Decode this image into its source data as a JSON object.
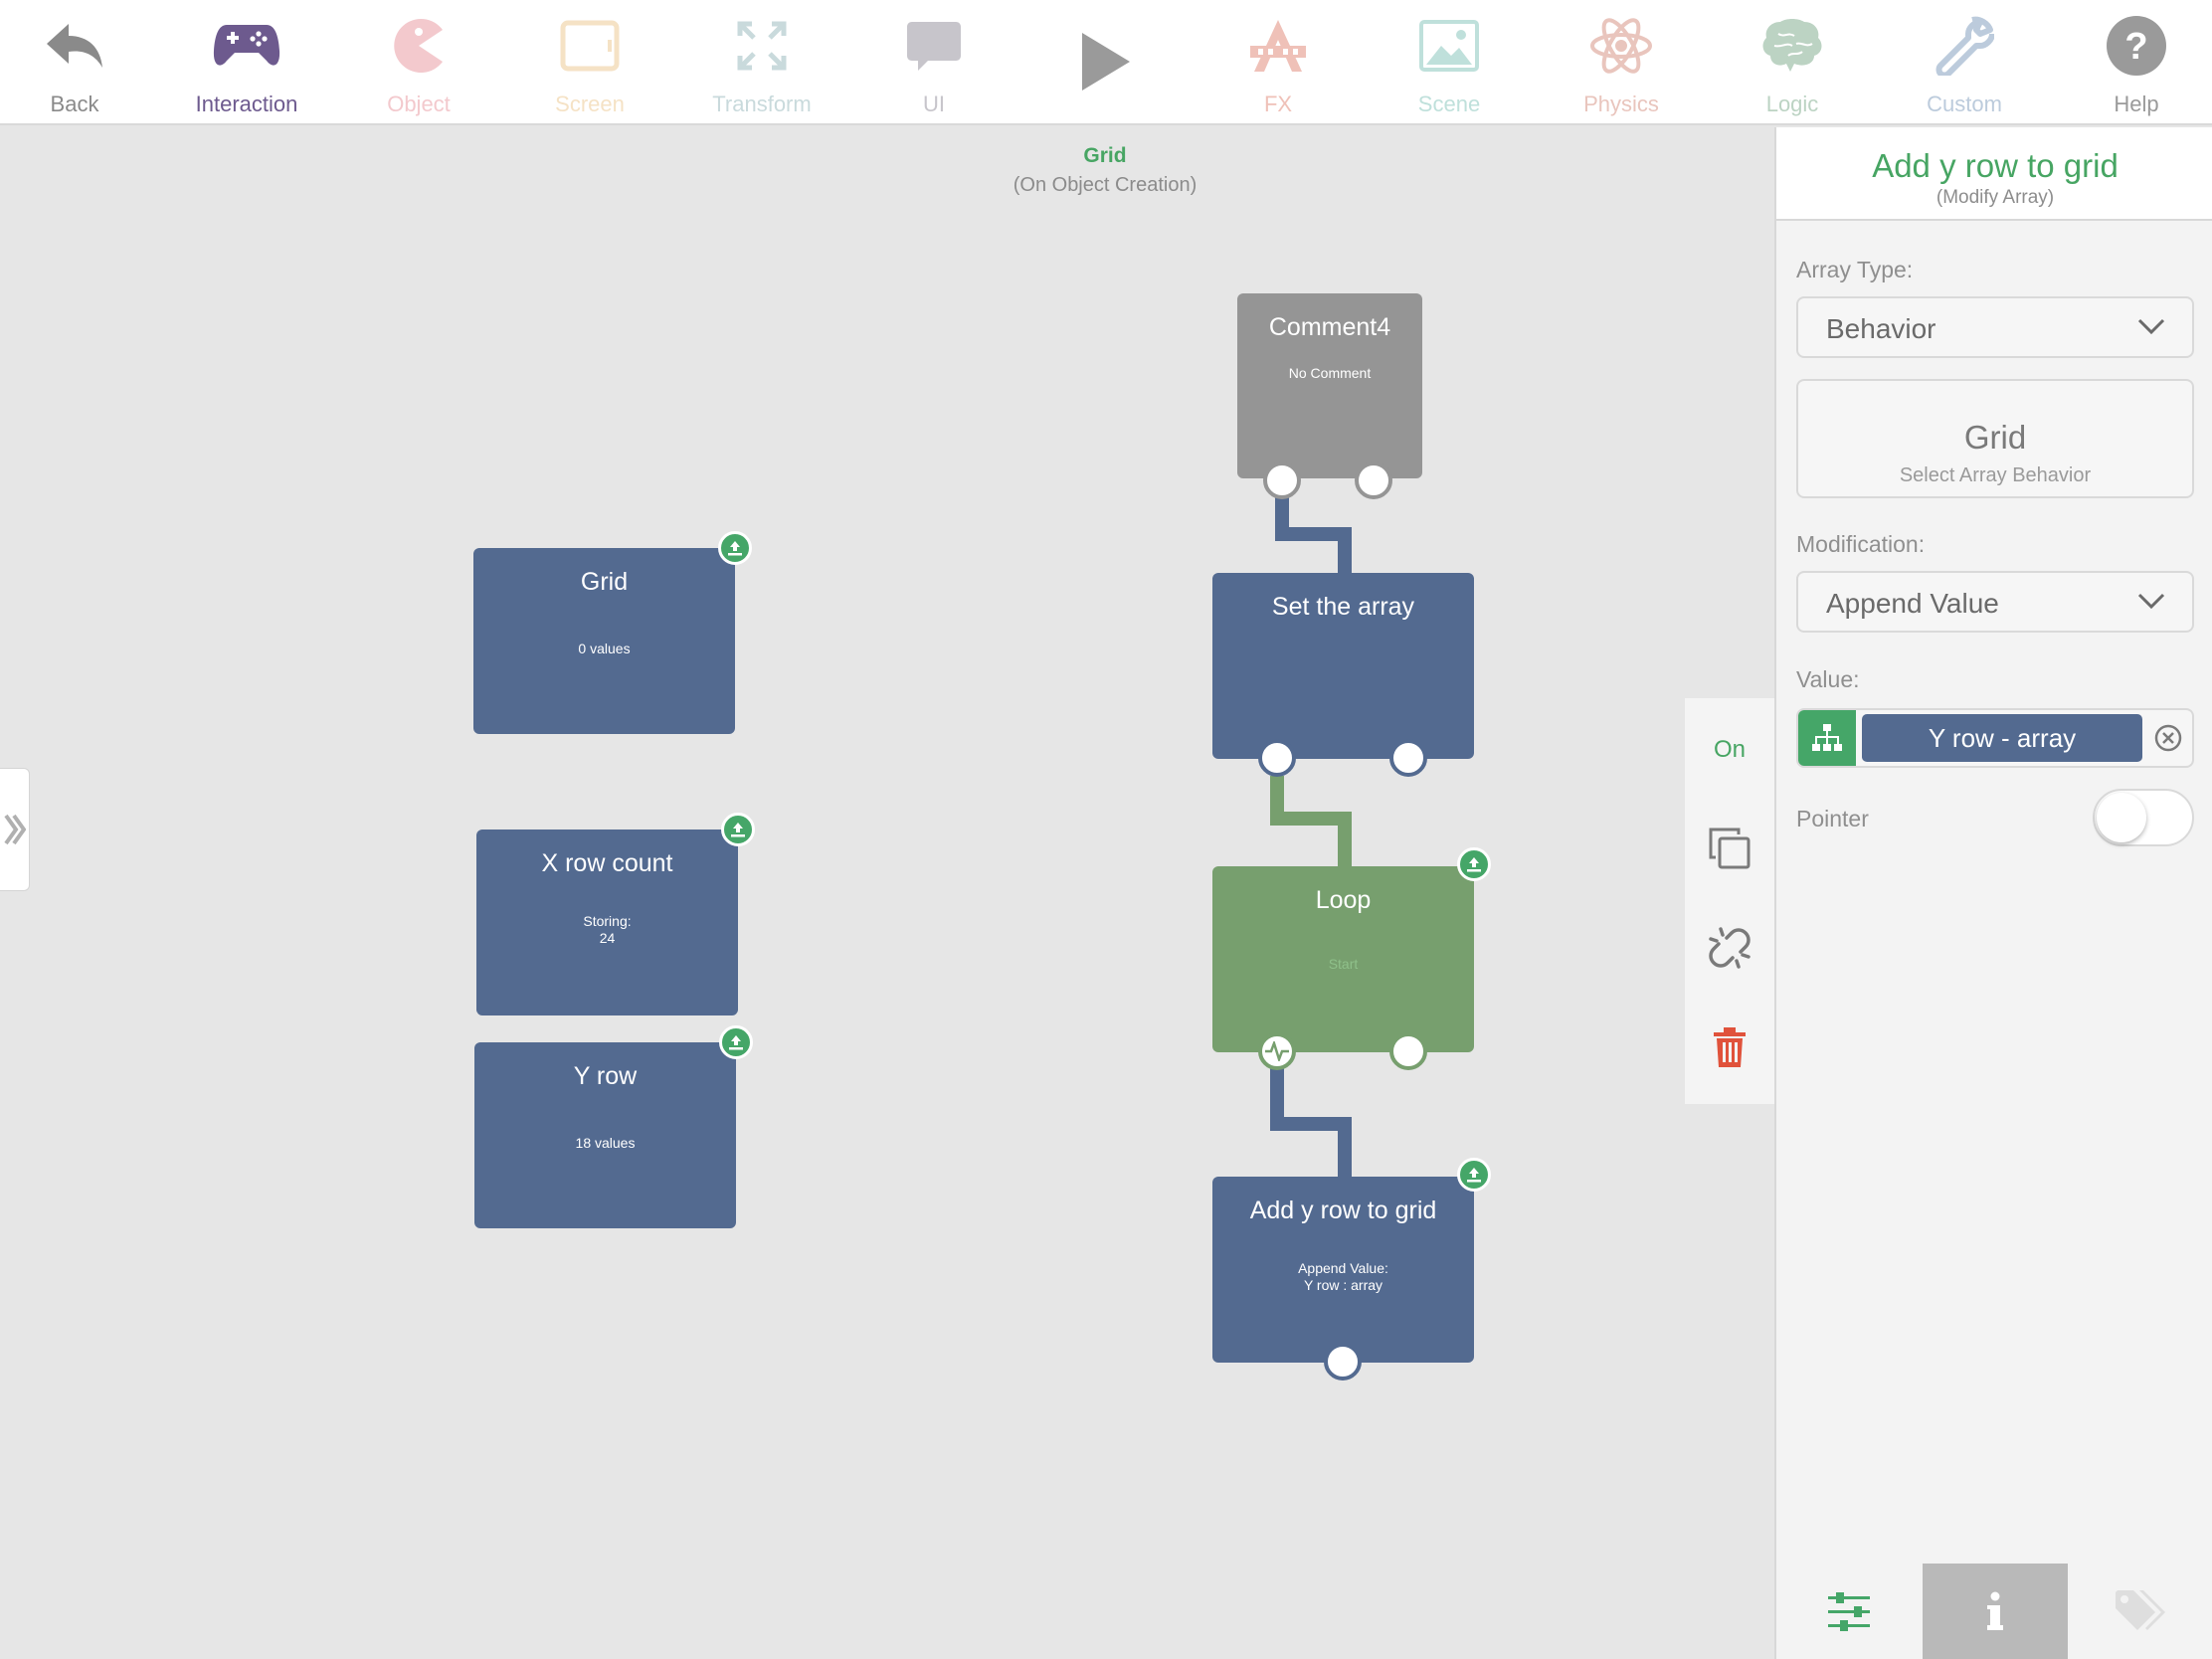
{
  "toolbar": {
    "items": [
      {
        "label": "Back",
        "icon": "back-arrow-icon",
        "color": "#8a8a8a"
      },
      {
        "label": "Interaction",
        "icon": "gamepad-icon",
        "color": "#6d5a8e"
      },
      {
        "label": "Object",
        "icon": "pacman-icon",
        "color": "#f3c9cd"
      },
      {
        "label": "Screen",
        "icon": "tablet-icon",
        "color": "#f5e2c5"
      },
      {
        "label": "Transform",
        "icon": "expand-icon",
        "color": "#c9dadc"
      },
      {
        "label": "UI",
        "icon": "speech-bubble-icon",
        "color": "#c7c5cb"
      },
      {
        "label": "",
        "icon": "play-icon",
        "color": "#9a9a9a"
      },
      {
        "label": "FX",
        "icon": "fx-icon",
        "color": "#efc1b8"
      },
      {
        "label": "Scene",
        "icon": "picture-icon",
        "color": "#bfe0db"
      },
      {
        "label": "Physics",
        "icon": "atom-icon",
        "color": "#e9c5bd"
      },
      {
        "label": "Logic",
        "icon": "brain-icon",
        "color": "#bcd3c3"
      },
      {
        "label": "Custom",
        "icon": "wrench-icon",
        "color": "#bccbdc"
      },
      {
        "label": "Help",
        "icon": "help-icon",
        "color": "#9a9a9a"
      }
    ]
  },
  "canvas": {
    "title": "Grid",
    "subtitle": "(On Object Creation)",
    "blocks": {
      "comment": {
        "title": "Comment4",
        "subtitle": "No Comment"
      },
      "grid": {
        "title": "Grid",
        "subtitle": "0 values"
      },
      "xrow": {
        "title": "X row count",
        "line1": "Storing:",
        "line2": "24"
      },
      "yrow": {
        "title": "Y row",
        "subtitle": "18 values"
      },
      "set": {
        "title": "Set the array",
        "subtitle": ""
      },
      "loop": {
        "title": "Loop",
        "subtitle": "Start"
      },
      "add": {
        "title": "Add y row to grid",
        "line1": "Append Value:",
        "line2": "Y row : array"
      }
    }
  },
  "side_tools": {
    "on_label": "On",
    "items": [
      "copy-icon",
      "unlink-icon",
      "trash-icon"
    ]
  },
  "panel": {
    "title": "Add y row to grid",
    "subtitle": "(Modify Array)",
    "array_type_label": "Array Type:",
    "array_type_value": "Behavior",
    "behavior_name": "Grid",
    "behavior_hint": "Select Array Behavior",
    "modification_label": "Modification:",
    "modification_value": "Append Value",
    "value_label": "Value:",
    "value_chip": "Y row - array",
    "pointer_label": "Pointer",
    "pointer_on": false,
    "tabs": [
      "settings-sliders-icon",
      "info-icon",
      "tag-icon"
    ]
  },
  "colors": {
    "accent_green": "#47a563",
    "block_blue": "#536a90",
    "block_green": "#779f6e",
    "block_gray": "#959595",
    "delete_red": "#e0523b"
  }
}
